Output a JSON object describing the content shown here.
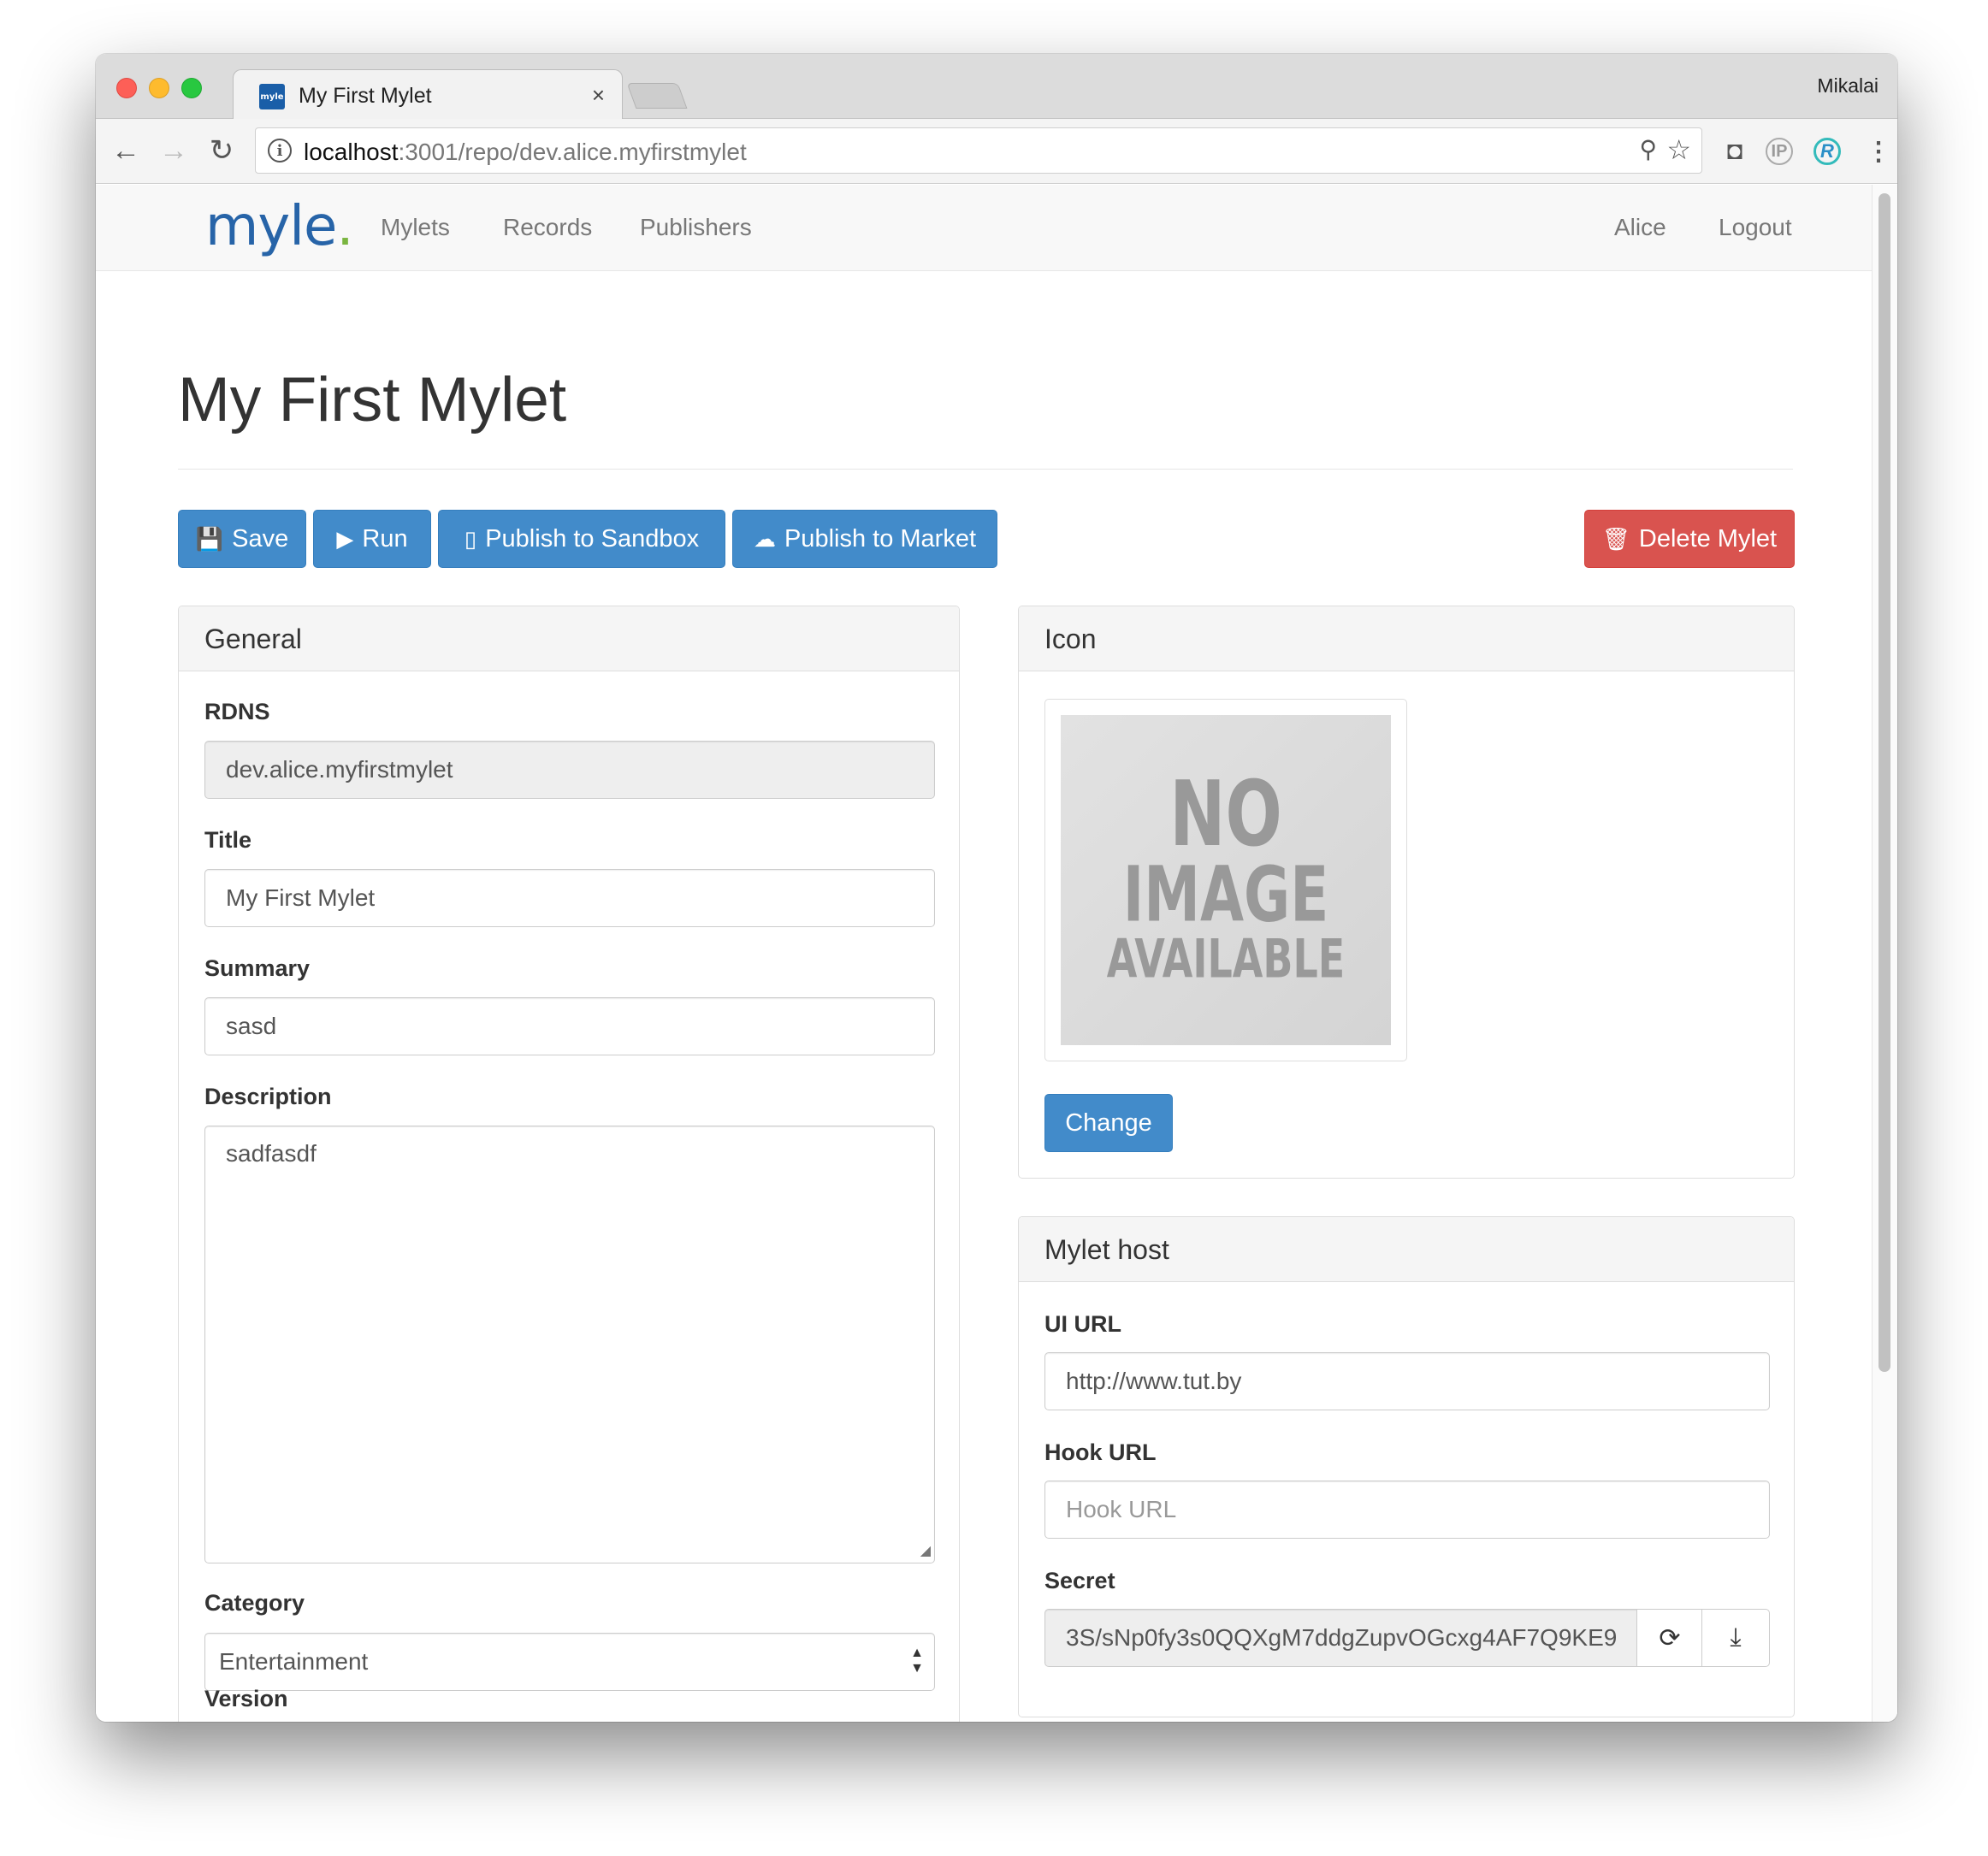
{
  "browser": {
    "tab_title": "My First Mylet",
    "tab_favicon": "myle",
    "tab_close": "×",
    "profile_name": "Mikalai",
    "url_host": "localhost",
    "url_rest": ":3001/repo/dev.alice.myfirstmylet",
    "icons": {
      "back": "←",
      "forward": "→",
      "reload": "↻",
      "info": "i",
      "key": "⚲",
      "star": "☆",
      "pocket": "◘",
      "ip": "IP",
      "r": "R",
      "menu": "⋮"
    }
  },
  "navbar": {
    "brand": "myle",
    "brand_dot": ".",
    "links": [
      "Mylets",
      "Records",
      "Publishers"
    ],
    "user": "Alice",
    "logout": "Logout"
  },
  "page": {
    "title": "My First Mylet"
  },
  "actions": {
    "save": "Save",
    "run": "Run",
    "publish_sandbox": "Publish to Sandbox",
    "publish_market": "Publish to Market",
    "delete": "Delete Mylet",
    "icons": {
      "save": "💾",
      "run": "▶",
      "sandbox": "▯",
      "market": "☁",
      "delete": "🗑"
    }
  },
  "general": {
    "heading": "General",
    "rdns_label": "RDNS",
    "rdns_value": "dev.alice.myfirstmylet",
    "title_label": "Title",
    "title_value": "My First Mylet",
    "summary_label": "Summary",
    "summary_value": "sasd",
    "description_label": "Description",
    "description_value": "sadfasdf",
    "category_label": "Category",
    "category_value": "Entertainment",
    "version_label": "Version"
  },
  "icon_panel": {
    "heading": "Icon",
    "no_image_1": "NO",
    "no_image_2": "IMAGE",
    "no_image_3": "AVAILABLE",
    "change": "Change"
  },
  "host_panel": {
    "heading": "Mylet host",
    "ui_url_label": "UI URL",
    "ui_url_value": "http://www.tut.by",
    "hook_url_label": "Hook URL",
    "hook_url_placeholder": "Hook URL",
    "secret_label": "Secret",
    "secret_value": "3S/sNp0fy3s0QQXgM7ddgZupvOGcxg4AF7Q9KE9",
    "refresh_icon": "⟳",
    "copy_icon": "⤓"
  },
  "colors": {
    "primary": "#428bca",
    "danger": "#d9534f",
    "brand": "#2764a8",
    "brand_dot": "#7ab540"
  }
}
